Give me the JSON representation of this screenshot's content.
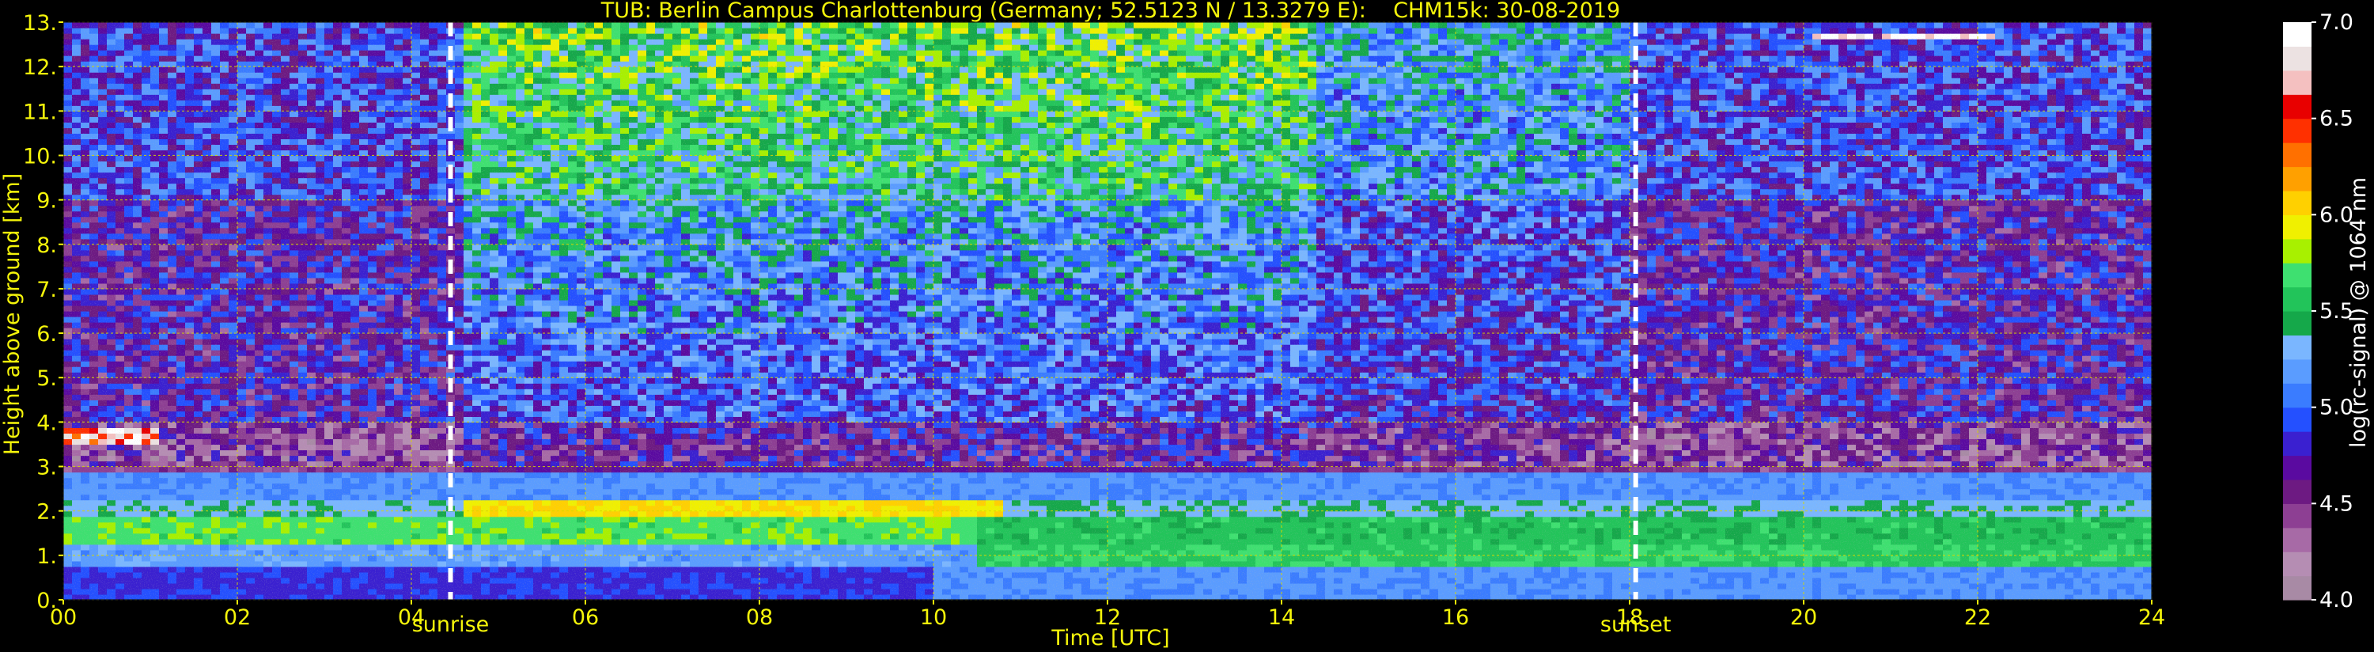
{
  "chart_data": {
    "type": "heatmap",
    "title": "TUB: Berlin Campus Charlottenburg (Germany; 52.5123 N / 13.3279 E):    CHM15k: 30-08-2019",
    "xlabel": "Time [UTC]",
    "ylabel": "Height above ground [km]",
    "colorbar_label": "log(rc-signal) @ 1064 nm",
    "xlim": [
      0,
      24
    ],
    "ylim": [
      0,
      13
    ],
    "x_ticks": [
      "00",
      "02",
      "04",
      "06",
      "08",
      "10",
      "12",
      "14",
      "16",
      "18",
      "20",
      "22",
      "24"
    ],
    "y_ticks": [
      "0.",
      "1.",
      "2.",
      "3.",
      "4.",
      "5.",
      "6.",
      "7.",
      "8.",
      "9.",
      "10.",
      "11.",
      "12.",
      "13."
    ],
    "grid": true,
    "colorbar_range": [
      4.0,
      7.0
    ],
    "colorbar_ticks": [
      "4.0",
      "4.5",
      "5.0",
      "5.5",
      "6.0",
      "6.5",
      "7.0"
    ],
    "colormap": [
      "#a88aa5",
      "#b58db3",
      "#a76aa6",
      "#8d3f93",
      "#6d1a82",
      "#5a0aa0",
      "#3a20d0",
      "#2450ff",
      "#3a7cff",
      "#5a9cff",
      "#7ab6ff",
      "#15a84a",
      "#22c45a",
      "#3ee070",
      "#a8f000",
      "#f0f000",
      "#ffd000",
      "#ffa000",
      "#ff7000",
      "#ff3000",
      "#e80000",
      "#f4c0c0",
      "#ece2e2",
      "#ffffff"
    ],
    "annotations": [
      {
        "label": "sunrise",
        "time": 4.45
      },
      {
        "label": "sunset",
        "time": 18.07
      }
    ],
    "colors": {
      "axis_text": "#f5f50a",
      "grid": "#d8d800",
      "marker_line": "#ffffff",
      "background": "#000000"
    }
  }
}
